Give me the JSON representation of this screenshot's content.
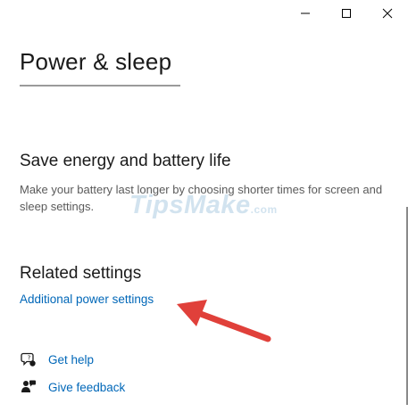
{
  "window": {
    "controls": {
      "minimize_icon": "minimize-icon",
      "maximize_icon": "maximize-icon",
      "close_icon": "close-icon"
    }
  },
  "page": {
    "title": "Power & sleep"
  },
  "energy": {
    "heading": "Save energy and battery life",
    "description": "Make your battery last longer by choosing shorter times for screen and sleep settings."
  },
  "watermark": {
    "text": "TipsMake",
    "suffix": ".com"
  },
  "related": {
    "heading": "Related settings",
    "link_label": "Additional power settings"
  },
  "help": {
    "get_help_label": "Get help",
    "give_feedback_label": "Give feedback"
  },
  "colors": {
    "link": "#0067b8",
    "arrow": "#e0403a",
    "text": "#1a1a1a",
    "secondary_text": "#5a5a5a"
  }
}
